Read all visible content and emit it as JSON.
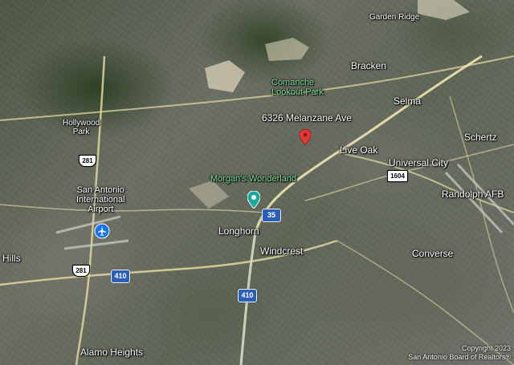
{
  "map": {
    "address_label": "6326 Melanzane Ave",
    "places": {
      "garden_ridge": "Garden Ridge",
      "bracken": "Bracken",
      "comanche_park": "Comanche\nLookout Park",
      "selma": "Selma",
      "hollywood_park": "Hollywood\nPark",
      "live_oak": "Live Oak",
      "schertz": "Schertz",
      "universal_city": "Universal City",
      "morgans_wonderland": "Morgan's Wonderland",
      "randolph_afb": "Randolph AFB",
      "sa_airport": "San Antonio\nInternational\nAirport",
      "longhorn": "Longhorn",
      "windcrest": "Windcrest",
      "converse": "Converse",
      "hills": "Hills",
      "alamo_heights": "Alamo Heights"
    },
    "shields": {
      "us281_top": "281",
      "us281_bottom": "281",
      "i35": "35",
      "i410_left": "410",
      "i410_center": "410",
      "loop1604": "1604"
    },
    "marker_color": "#e53935",
    "attraction_icon_color": "#1aa99a",
    "airport_icon_color": "#1a73e8",
    "park_label_color": "#7fe39a",
    "copyright_line1": "Copyright 2023",
    "copyright_line2": "San Antonio Board of Realtors®"
  }
}
